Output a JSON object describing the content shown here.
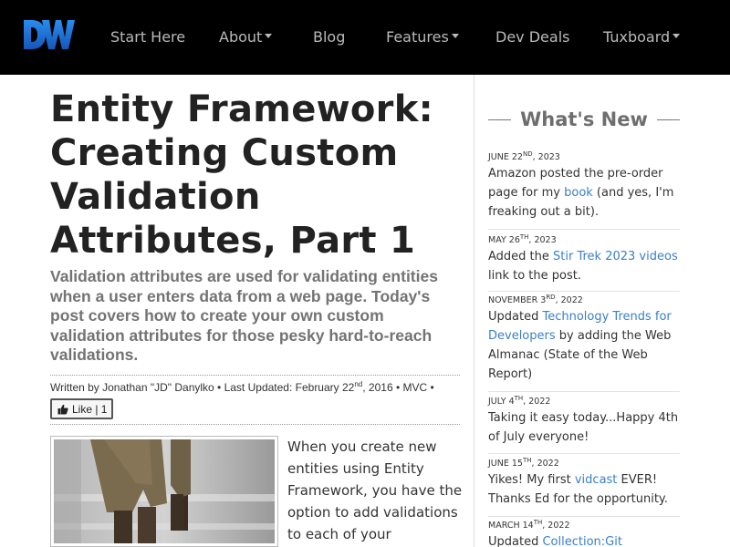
{
  "nav": {
    "logo_text": "DW",
    "items": [
      {
        "label": "Start Here",
        "dropdown": false
      },
      {
        "label": "About",
        "dropdown": true
      },
      {
        "label": "Blog",
        "dropdown": false
      },
      {
        "label": "Features",
        "dropdown": true
      },
      {
        "label": "Dev Deals",
        "dropdown": false
      },
      {
        "label": "Tuxboard",
        "dropdown": true
      }
    ]
  },
  "article": {
    "title": "Entity Framework: Creating Custom Validation Attributes, Part 1",
    "lead": "Validation attributes are used for validating entities when a user enters data from a web page. Today's post covers how to create your own custom validation attributes for those pesky hard-to-reach validations.",
    "byline_prefix": "Written by Jonathan \"JD\" Danylko • Last Updated: February 22",
    "byline_sup": "nd",
    "byline_suffix": ", 2016 • MVC •",
    "like_label": "Like | 1",
    "body_text": "When you create new entities using Entity Framework, you have the option to add validations to each of your properties."
  },
  "sidebar": {
    "heading": "What's New",
    "items": [
      {
        "date": "June 22",
        "date_sup": "nd",
        "date_year": ", 2023",
        "text_before": "Amazon posted the pre-order page for my ",
        "link": "book",
        "text_after": " (and yes, I'm freaking out a bit)."
      },
      {
        "date": "May 26",
        "date_sup": "th",
        "date_year": ", 2023",
        "text_before": "Added the ",
        "link": "Stir Trek 2023 videos",
        "text_after": " link to the post."
      },
      {
        "date": "November 3",
        "date_sup": "rd",
        "date_year": ", 2022",
        "text_before": "Updated ",
        "link": "Technology Trends for Developers",
        "text_after": " by adding the Web Almanac (State of the Web Report)"
      },
      {
        "date": "July 4",
        "date_sup": "th",
        "date_year": ", 2022",
        "text_before": "Taking it easy today...Happy 4th of July everyone!",
        "link": "",
        "text_after": ""
      },
      {
        "date": "June 15",
        "date_sup": "th",
        "date_year": ", 2022",
        "text_before": "Yikes! My first ",
        "link": "vidcast",
        "text_after": " EVER! Thanks Ed for the opportunity."
      },
      {
        "date": "March 14",
        "date_sup": "th",
        "date_year": ", 2022",
        "text_before": "Updated ",
        "link": "Collection:Git Resources",
        "text_after": ""
      }
    ]
  },
  "colors": {
    "nav_bg": "#000000",
    "nav_text": "#b9b9b9",
    "logo_blue": "#1e6fd0",
    "link": "#3a7fc8",
    "lead_gray": "#737373"
  }
}
